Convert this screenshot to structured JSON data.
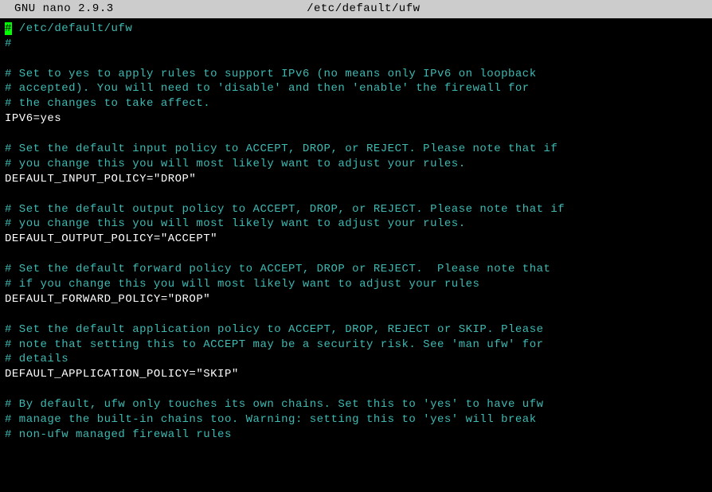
{
  "header": {
    "app": "GNU nano 2.9.3",
    "filename": "/etc/default/ufw"
  },
  "lines": [
    {
      "type": "cursor-comment",
      "cursor": "#",
      "text": " /etc/default/ufw"
    },
    {
      "type": "comment",
      "text": "#"
    },
    {
      "type": "blank",
      "text": ""
    },
    {
      "type": "comment",
      "text": "# Set to yes to apply rules to support IPv6 (no means only IPv6 on loopback"
    },
    {
      "type": "comment",
      "text": "# accepted). You will need to 'disable' and then 'enable' the firewall for"
    },
    {
      "type": "comment",
      "text": "# the changes to take affect."
    },
    {
      "type": "value",
      "text": "IPV6=yes"
    },
    {
      "type": "blank",
      "text": ""
    },
    {
      "type": "comment",
      "text": "# Set the default input policy to ACCEPT, DROP, or REJECT. Please note that if"
    },
    {
      "type": "comment",
      "text": "# you change this you will most likely want to adjust your rules."
    },
    {
      "type": "value",
      "text": "DEFAULT_INPUT_POLICY=\"DROP\""
    },
    {
      "type": "blank",
      "text": ""
    },
    {
      "type": "comment",
      "text": "# Set the default output policy to ACCEPT, DROP, or REJECT. Please note that if"
    },
    {
      "type": "comment",
      "text": "# you change this you will most likely want to adjust your rules."
    },
    {
      "type": "value",
      "text": "DEFAULT_OUTPUT_POLICY=\"ACCEPT\""
    },
    {
      "type": "blank",
      "text": ""
    },
    {
      "type": "comment",
      "text": "# Set the default forward policy to ACCEPT, DROP or REJECT.  Please note that"
    },
    {
      "type": "comment",
      "text": "# if you change this you will most likely want to adjust your rules"
    },
    {
      "type": "value",
      "text": "DEFAULT_FORWARD_POLICY=\"DROP\""
    },
    {
      "type": "blank",
      "text": ""
    },
    {
      "type": "comment",
      "text": "# Set the default application policy to ACCEPT, DROP, REJECT or SKIP. Please"
    },
    {
      "type": "comment",
      "text": "# note that setting this to ACCEPT may be a security risk. See 'man ufw' for"
    },
    {
      "type": "comment",
      "text": "# details"
    },
    {
      "type": "value",
      "text": "DEFAULT_APPLICATION_POLICY=\"SKIP\""
    },
    {
      "type": "blank",
      "text": ""
    },
    {
      "type": "comment",
      "text": "# By default, ufw only touches its own chains. Set this to 'yes' to have ufw"
    },
    {
      "type": "comment",
      "text": "# manage the built-in chains too. Warning: setting this to 'yes' will break"
    },
    {
      "type": "comment",
      "text": "# non-ufw managed firewall rules"
    }
  ]
}
